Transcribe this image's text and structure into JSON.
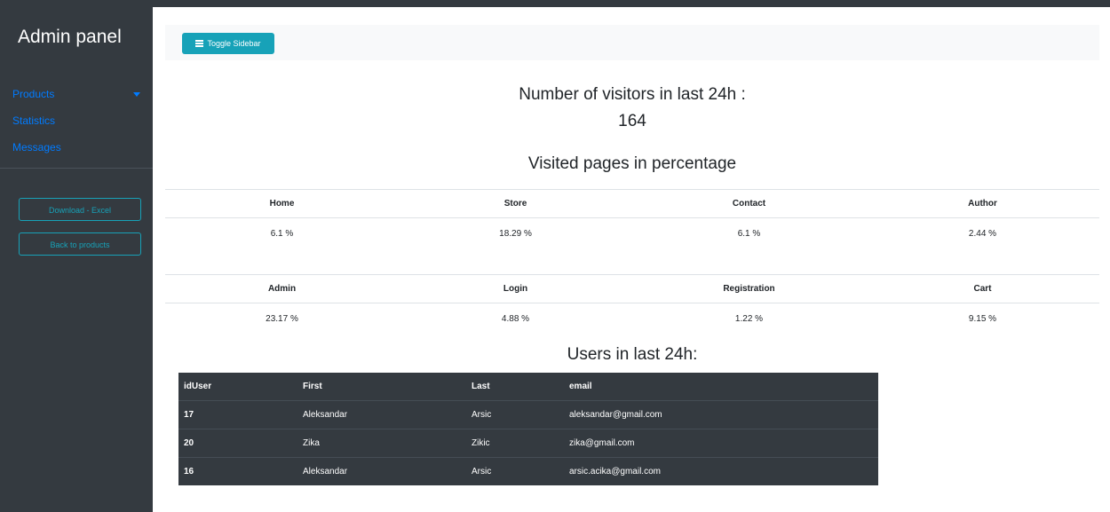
{
  "sidebar": {
    "title": "Admin panel",
    "menu": [
      {
        "label": "Products",
        "has_dropdown": true
      },
      {
        "label": "Statistics"
      },
      {
        "label": "Messages"
      }
    ],
    "buttons": {
      "download_excel": "Download - Excel",
      "back_to_products": "Back to products"
    }
  },
  "navbar": {
    "toggle_label": "Toggle Sidebar"
  },
  "stats": {
    "visitors_heading": "Number of visitors in last 24h :",
    "visitors_count": "164",
    "visited_heading": "Visited pages in percentage",
    "pages_row1": {
      "headers": [
        "Home",
        "Store",
        "Contact",
        "Author"
      ],
      "values": [
        "6.1 %",
        "18.29 %",
        "6.1 %",
        "2.44 %"
      ]
    },
    "pages_row2": {
      "headers": [
        "Admin",
        "Login",
        "Registration",
        "Cart"
      ],
      "values": [
        "23.17 %",
        "4.88 %",
        "1.22 %",
        "9.15 %"
      ]
    }
  },
  "users": {
    "heading": "Users in last 24h:",
    "columns": [
      "idUser",
      "First",
      "Last",
      "email"
    ],
    "rows": [
      [
        "17",
        "Aleksandar",
        "Arsic",
        "aleksandar@gmail.com"
      ],
      [
        "20",
        "Zika",
        "Zikic",
        "zika@gmail.com"
      ],
      [
        "16",
        "Aleksandar",
        "Arsic",
        "arsic.acika@gmail.com"
      ]
    ]
  },
  "colors": {
    "sidebar_bg": "#343a40",
    "link": "#007bff",
    "info": "#17a2b8",
    "navbar_bg": "#f8f9fa"
  }
}
